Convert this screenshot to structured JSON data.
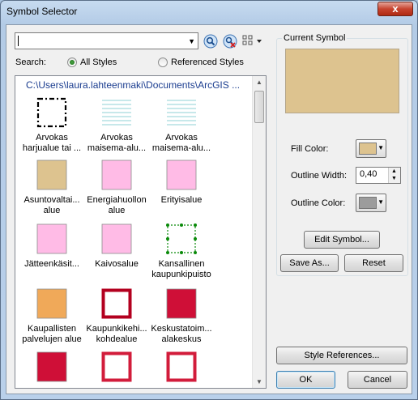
{
  "window": {
    "title": "Symbol Selector",
    "close_label": "x"
  },
  "search": {
    "value": "",
    "label": "Search:",
    "options": [
      {
        "label": "All Styles",
        "selected": true
      },
      {
        "label": "Referenced Styles",
        "selected": false
      }
    ]
  },
  "list": {
    "path": "C:\\Users\\laura.lahteenmaki\\Documents\\ArcGIS ...",
    "symbols": [
      {
        "label_lines": [
          "Arvokas",
          "harjualue tai ..."
        ],
        "kind": "dashed-outline",
        "color": "#000000"
      },
      {
        "label_lines": [
          "Arvokas",
          "maisema-alu..."
        ],
        "kind": "hatched",
        "color": "#8fd0d6"
      },
      {
        "label_lines": [
          "Arvokas",
          "maisema-alu..."
        ],
        "kind": "hatched",
        "color": "#8fd0d6"
      },
      {
        "label_lines": [
          "Asuntovaltai...",
          "alue"
        ],
        "kind": "fill",
        "color": "#ddc38f"
      },
      {
        "label_lines": [
          "Energiahuollon",
          "alue"
        ],
        "kind": "fill",
        "color": "#ffbbe6"
      },
      {
        "label_lines": [
          "Erityisalue"
        ],
        "kind": "fill",
        "color": "#ffbbe6"
      },
      {
        "label_lines": [
          "Jätteenkäsit..."
        ],
        "kind": "fill",
        "color": "#ffbbe6"
      },
      {
        "label_lines": [
          "Kaivosalue"
        ],
        "kind": "fill",
        "color": "#ffbbe6"
      },
      {
        "label_lines": [
          "Kansallinen",
          "kaupunkipuisto"
        ],
        "kind": "green-dotted",
        "color": "#0a8a0a"
      },
      {
        "label_lines": [
          "Kaupallisten",
          "palvelujen alue"
        ],
        "kind": "fill",
        "color": "#f0a959"
      },
      {
        "label_lines": [
          "Kaupunkikehi...",
          "kohdealue"
        ],
        "kind": "outline",
        "color": "#b3001f"
      },
      {
        "label_lines": [
          "Keskustatoim...",
          "alakeskus"
        ],
        "kind": "fill",
        "color": "#cf0f37"
      },
      {
        "label_lines": [],
        "kind": "fill",
        "color": "#cf0f37"
      },
      {
        "label_lines": [],
        "kind": "outline",
        "color": "#d21c3b"
      },
      {
        "label_lines": [],
        "kind": "outline",
        "color": "#d21c3b"
      }
    ]
  },
  "current_symbol": {
    "title": "Current Symbol",
    "preview_color": "#ddc38f",
    "fill_color_label": "Fill Color:",
    "fill_color": "#ddc38f",
    "outline_width_label": "Outline Width:",
    "outline_width": "0,40",
    "outline_color_label": "Outline Color:",
    "outline_color": "#9c9c9c"
  },
  "buttons": {
    "edit_symbol": "Edit Symbol...",
    "save_as": "Save As...",
    "reset": "Reset",
    "style_references": "Style References...",
    "ok": "OK",
    "cancel": "Cancel"
  }
}
